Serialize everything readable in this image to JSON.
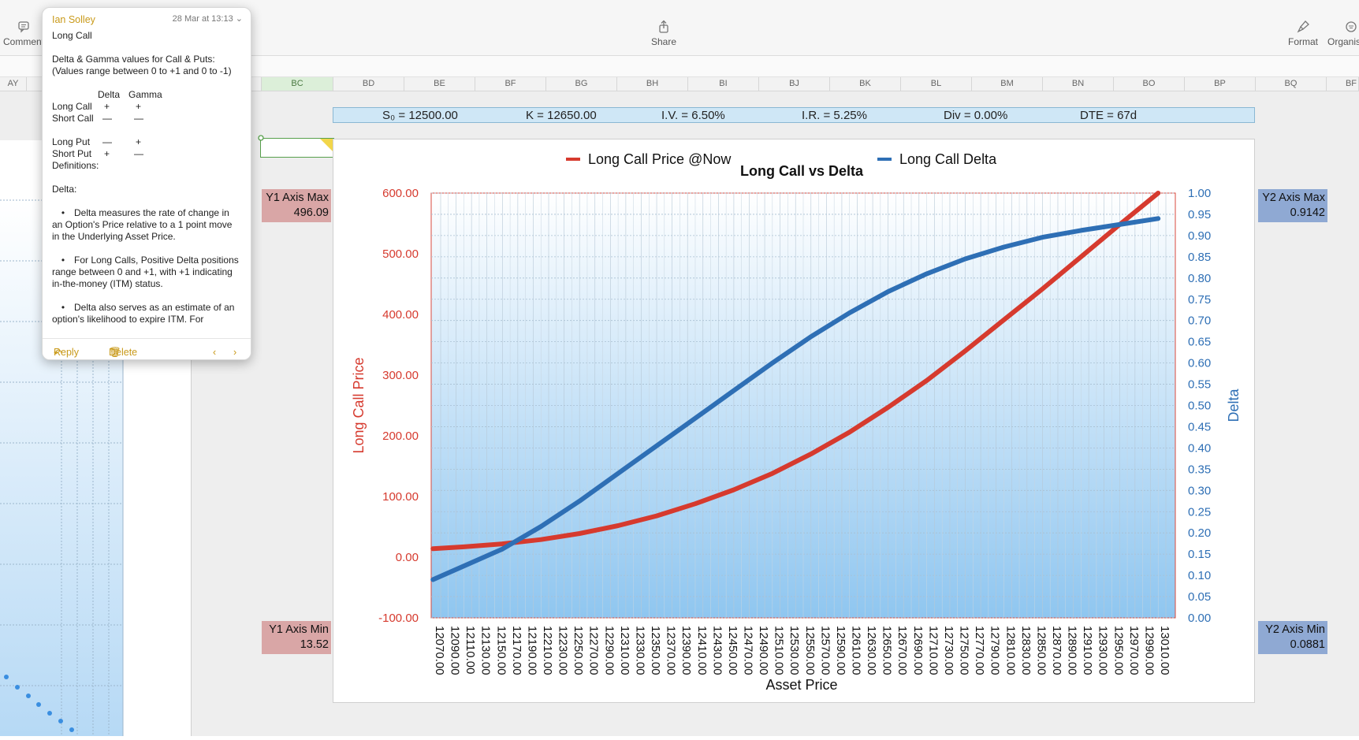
{
  "toolbar": {
    "comment_label": "Comment",
    "share_label": "Share",
    "format_label": "Format",
    "organise_label": "Organis"
  },
  "columns": [
    "AY",
    "BC",
    "BD",
    "BE",
    "BF",
    "BG",
    "BH",
    "BI",
    "BJ",
    "BK",
    "BL",
    "BM",
    "BN",
    "BO",
    "BP",
    "BQ",
    "BF"
  ],
  "params": {
    "s0": "S₀ = 12500.00",
    "k": "K = 12650.00",
    "iv": "I.V. = 6.50%",
    "ir": "I.R. = 5.25%",
    "div": "Div = 0.00%",
    "dte": "DTE = 67d"
  },
  "axis_boxes": {
    "y1_max_label": "Y1 Axis Max",
    "y1_max_value": "496.09",
    "y1_min_label": "Y1 Axis Min",
    "y1_min_value": "13.52",
    "y2_max_label": "Y2 Axis Max",
    "y2_max_value": "0.9142",
    "y2_min_label": "Y2 Axis Min",
    "y2_min_value": "0.0881"
  },
  "comment": {
    "author": "Ian Solley",
    "date": "28 Mar at 13:13",
    "title": "Long Call",
    "intro": "Delta & Gamma values for Call & Puts:\n(Values range between 0 to +1 and 0 to -1)",
    "table": {
      "col_delta": "Delta",
      "col_gamma": "Gamma",
      "rows": [
        {
          "name": "Long Call",
          "delta": "+",
          "gamma": "+"
        },
        {
          "name": "Short Call",
          "delta": "—",
          "gamma": "—"
        },
        {
          "name": "Long Put",
          "delta": "—",
          "gamma": "+"
        },
        {
          "name": "Short Put",
          "delta": "+",
          "gamma": "—"
        }
      ]
    },
    "definitions": "Definitions:",
    "delta_heading": "Delta:",
    "bullets": [
      "Delta measures the rate of change in an Option's Price relative to a 1 point move in the Underlying Asset Price.",
      "For Long Calls, Positive Delta positions range between 0 and +1, with +1 indicating in-the-money (ITM) status.",
      "Delta also serves as an estimate of an option's likelihood to expire ITM. For"
    ],
    "reply_label": "Reply",
    "delete_label": "Delete"
  },
  "chart_data": {
    "type": "line",
    "title": "Long Call vs Delta",
    "xlabel": "Asset Price",
    "ylabel": "Long Call Price",
    "y2label": "Delta",
    "ylim": [
      -100,
      600
    ],
    "y2lim": [
      0,
      1
    ],
    "y_ticks": [
      "600.00",
      "500.00",
      "400.00",
      "300.00",
      "200.00",
      "100.00",
      "0.00",
      "-100.00"
    ],
    "y2_ticks": [
      "1.00",
      "0.95",
      "0.90",
      "0.85",
      "0.80",
      "0.75",
      "0.70",
      "0.65",
      "0.60",
      "0.55",
      "0.50",
      "0.45",
      "0.40",
      "0.35",
      "0.30",
      "0.25",
      "0.20",
      "0.15",
      "0.10",
      "0.05",
      "0.00"
    ],
    "x": [
      12070,
      12090,
      12110,
      12130,
      12150,
      12170,
      12190,
      12210,
      12230,
      12250,
      12270,
      12290,
      12310,
      12330,
      12350,
      12370,
      12390,
      12410,
      12430,
      12450,
      12470,
      12490,
      12510,
      12530,
      12550,
      12570,
      12590,
      12610,
      12630,
      12650,
      12670,
      12690,
      12710,
      12730,
      12750,
      12770,
      12790,
      12810,
      12830,
      12850,
      12870,
      12890,
      12910,
      12930,
      12950,
      12970,
      12990,
      13010
    ],
    "x_tick_labels": [
      "12070.00",
      "12090.00",
      "12110.00",
      "12130.00",
      "12150.00",
      "12170.00",
      "12190.00",
      "12210.00",
      "12230.00",
      "12250.00",
      "12270.00",
      "12290.00",
      "12310.00",
      "12330.00",
      "12350.00",
      "12370.00",
      "12390.00",
      "12410.00",
      "12430.00",
      "12450.00",
      "12470.00",
      "12490.00",
      "12510.00",
      "12530.00",
      "12550.00",
      "12570.00",
      "12590.00",
      "12610.00",
      "12630.00",
      "12650.00",
      "12670.00",
      "12690.00",
      "12710.00",
      "12730.00",
      "12750.00",
      "12770.00",
      "12790.00",
      "12810.00",
      "12830.00",
      "12850.00",
      "12870.00",
      "12890.00",
      "12910.00",
      "12930.00",
      "12950.00",
      "12970.00",
      "12990.00",
      "13010.00"
    ],
    "legend_position": "top",
    "series": [
      {
        "name": "Long Call Price @Now",
        "color": "#d63a2e",
        "axis": "y1",
        "x": [
          12060,
          12100,
          12150,
          12200,
          12250,
          12300,
          12350,
          12400,
          12450,
          12500,
          12550,
          12600,
          12650,
          12700,
          12750,
          12800,
          12850,
          12900,
          12950,
          13000
        ],
        "values": [
          14,
          17,
          22,
          29,
          39,
          52,
          68,
          88,
          111,
          138,
          170,
          206,
          247,
          291,
          340,
          391,
          442,
          495,
          548,
          600
        ]
      },
      {
        "name": "Long Call Delta",
        "color": "#2e6fb5",
        "axis": "y2",
        "x": [
          12060,
          12100,
          12150,
          12200,
          12250,
          12300,
          12350,
          12400,
          12450,
          12500,
          12550,
          12600,
          12650,
          12700,
          12750,
          12800,
          12850,
          12900,
          12950,
          13000
        ],
        "values": [
          0.09,
          0.122,
          0.162,
          0.215,
          0.275,
          0.34,
          0.405,
          0.47,
          0.535,
          0.6,
          0.662,
          0.718,
          0.768,
          0.81,
          0.845,
          0.873,
          0.896,
          0.912,
          0.926,
          0.94
        ]
      }
    ]
  }
}
